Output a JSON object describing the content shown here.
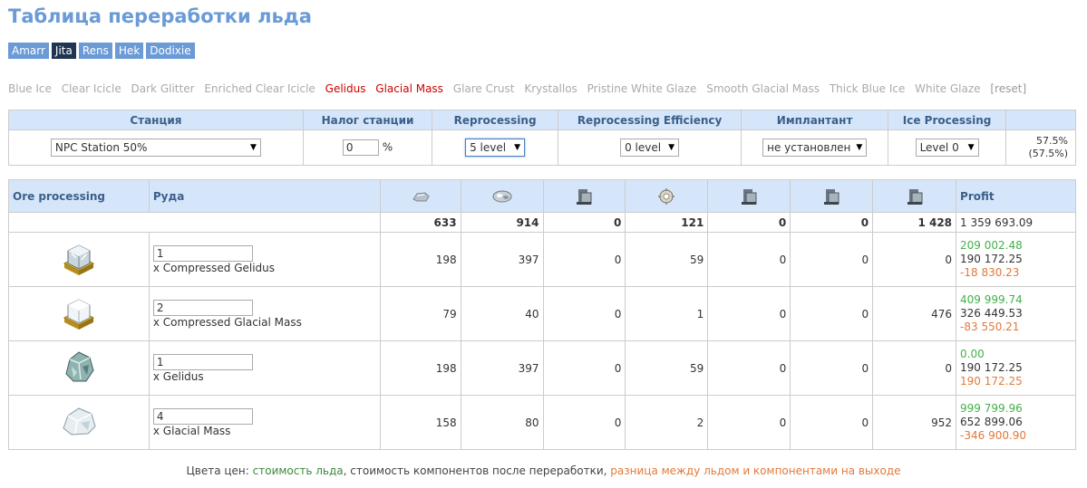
{
  "title": "Таблица переработки льда",
  "hubs": [
    {
      "label": "Amarr",
      "active": false
    },
    {
      "label": "Jita",
      "active": true
    },
    {
      "label": "Rens",
      "active": false
    },
    {
      "label": "Hek",
      "active": false
    },
    {
      "label": "Dodixie",
      "active": false
    }
  ],
  "filters": {
    "items": [
      {
        "label": "Blue Ice",
        "selected": false
      },
      {
        "label": "Clear Icicle",
        "selected": false
      },
      {
        "label": "Dark Glitter",
        "selected": false
      },
      {
        "label": "Enriched Clear Icicle",
        "selected": false
      },
      {
        "label": "Gelidus",
        "selected": true
      },
      {
        "label": "Glacial Mass",
        "selected": true
      },
      {
        "label": "Glare Crust",
        "selected": false
      },
      {
        "label": "Krystallos",
        "selected": false
      },
      {
        "label": "Pristine White Glaze",
        "selected": false
      },
      {
        "label": "Smooth Glacial Mass",
        "selected": false
      },
      {
        "label": "Thick Blue Ice",
        "selected": false
      },
      {
        "label": "White Glaze",
        "selected": false
      }
    ],
    "reset": "[reset]"
  },
  "settings": {
    "headers": {
      "station": "Станция",
      "tax": "Налог станции",
      "reprocessing": "Reprocessing",
      "efficiency": "Reprocessing Efficiency",
      "implant": "Имплантант",
      "ice": "Ice Processing"
    },
    "station_value": "NPC Station 50%",
    "tax_value": "0",
    "tax_unit": "%",
    "reprocessing_value": "5 level",
    "efficiency_value": "0 level",
    "implant_value": "не установлен",
    "ice_value": "Level 0",
    "yield": "57.5%",
    "yield_paren": "(57.5%)"
  },
  "ores": {
    "headers": {
      "processing": "Ore processing",
      "ore": "Руда",
      "profit": "Profit"
    },
    "mineral_icons": [
      "heavy-water-icon",
      "liquid-ozone-icon",
      "helium-isotopes-icon",
      "strontium-clathrates-icon",
      "hydrogen-isotopes-icon",
      "nitrogen-isotopes-icon",
      "oxygen-isotopes-icon"
    ],
    "totals": [
      "633",
      "914",
      "0",
      "121",
      "0",
      "0",
      "1 428"
    ],
    "total_profit": "1 359 693.09",
    "rows": [
      {
        "qty": "1",
        "name": "x Compressed Gelidus",
        "values": [
          "198",
          "397",
          "0",
          "59",
          "0",
          "0",
          "0"
        ],
        "price": "209 002.48",
        "components": "190 172.25",
        "diff": "-18 830.23",
        "icon": "compressed-gelidus-icon"
      },
      {
        "qty": "2",
        "name": "x Compressed Glacial Mass",
        "values": [
          "79",
          "40",
          "0",
          "1",
          "0",
          "0",
          "476"
        ],
        "price": "409 999.74",
        "components": "326 449.53",
        "diff": "-83 550.21",
        "icon": "compressed-glacial-mass-icon"
      },
      {
        "qty": "1",
        "name": "x Gelidus",
        "values": [
          "198",
          "397",
          "0",
          "59",
          "0",
          "0",
          "0"
        ],
        "price": "0.00",
        "components": "190 172.25",
        "diff": "190 172.25",
        "icon": "gelidus-icon"
      },
      {
        "qty": "4",
        "name": "x Glacial Mass",
        "values": [
          "158",
          "80",
          "0",
          "2",
          "0",
          "0",
          "952"
        ],
        "price": "999 799.96",
        "components": "652 899.06",
        "diff": "-346 900.90",
        "icon": "glacial-mass-icon"
      }
    ]
  },
  "legend": {
    "prefix": "Цвета цен: ",
    "ice_cost": "стоимость льда",
    "sep": ", ",
    "components_cost": "стоимость компонентов после переработки",
    "sep2": ", ",
    "difference": "разница между льдом и компонентами на выходе"
  },
  "colors": {
    "accent": "#6a9bd6",
    "header_bg": "#d6e6fa",
    "price_green": "#44b04a",
    "diff_orange": "#e07a3c",
    "filter_selected": "#cc0000"
  }
}
